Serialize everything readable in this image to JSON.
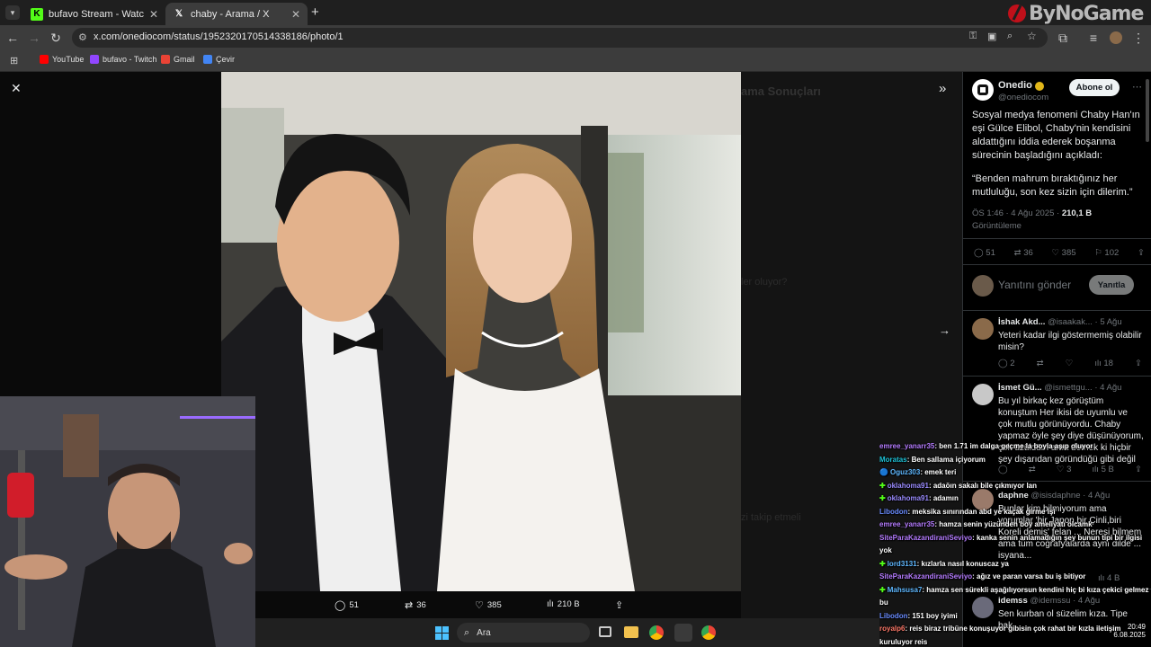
{
  "browser": {
    "tabs": [
      {
        "title": "bufavo Stream - Watch Live on",
        "icon_letter": "K",
        "icon_color": "#53fc18"
      },
      {
        "title": "chaby - Arama / X",
        "icon_letter": "𝕏",
        "icon_color": "#ffffff"
      }
    ],
    "url": "x.com/onediocom/status/1952320170514338186/photo/1",
    "bookmarks": [
      "YouTube",
      "bufavo - Twitch",
      "Gmail",
      "Çevir"
    ],
    "watermark": "ByNoGame"
  },
  "post": {
    "author_name": "Onedio",
    "author_handle": "@onediocom",
    "follow_label": "Abone ol",
    "text": "Sosyal medya fenomeni Chaby Han'ın eşi Gülce Elibol, Chaby'nin kendisini aldattığını iddia ederek boşanma sürecinin başladığını açıkladı:",
    "quote": "“Benden mahrum bıraktığınız her mutluluğu, son kez sizin için dilerim.”",
    "time": "ÖS 1:46 · 4 Ağu 2025 ·",
    "views_count": "210,1 B",
    "views_label": "Görüntüleme",
    "stats": {
      "replies": "51",
      "reposts": "36",
      "likes": "385",
      "bookmarks": "102"
    },
    "reply_placeholder": "Yanıtını gönder",
    "reply_button": "Yanıtla"
  },
  "photo_actions": {
    "replies": "51",
    "reposts": "36",
    "likes": "385",
    "views": "210 B"
  },
  "replies": [
    {
      "name": "İshak Akd...",
      "handle": "@isaakak...",
      "date": "· 5 Ağu",
      "text": "Yeteri kadar ilgi göstermemiş olabilir misin?",
      "replies": "2",
      "reposts": "",
      "likes": "",
      "views": "18",
      "avatar": "#8a6a4a"
    },
    {
      "name": "İsmet Gü...",
      "handle": "@ismettgu...",
      "date": "· 4 Ağu",
      "text": "Bu yıl birkaç kez görüştüm konuştum Her ikisi de uyumlu ve çok mutlu görünüyordu. Chaby yapmaz öyle şey diye düşünüyorum, çok üzüldüm ama demek ki hiçbir şey dışarıdan göründüğü gibi değil",
      "replies": "",
      "reposts": "",
      "likes": "3",
      "views": "5 B",
      "avatar": "#c8c8c8"
    },
    {
      "name": "daphne",
      "handle": "@isisdaphne",
      "date": "· 4 Ağu",
      "text": "Bunlar kim bilmiyorum ama yorumlar 'bir Japon,bir Çinli,biri Koreli demiş' felan ... Neresi bilmem ama tüm coğrafyalarda aynı dilde ... isyana...",
      "replies": "",
      "reposts": "",
      "likes": "",
      "views": "4 B",
      "avatar": "#9a7a6a"
    },
    {
      "name": "idemss",
      "handle": "@idemssu",
      "date": "· 4 Ağu",
      "text": "Sen kurban ol süzelim kıza. Tipe bak",
      "replies": "",
      "reposts": "",
      "likes": "",
      "views": "",
      "avatar": "#6a6a7a"
    }
  ],
  "chat": [
    {
      "user": "emree_yanarr35",
      "color": "#b57cff",
      "msg": ": ben 1.71 im dalga geçme la boyla aşıp oluyor",
      "badge": ""
    },
    {
      "user": "Moratas",
      "color": "#1fc3d8",
      "msg": ": Ben sallama içiyorum",
      "badge": ""
    },
    {
      "user": "Oguz303",
      "color": "#5fb8ff",
      "msg": ": emek teri",
      "badge": "🔵"
    },
    {
      "user": "oklahoma91",
      "color": "#9b8cff",
      "msg": ": adaöın sakalı bile çıkmıyor lan",
      "badge": "✚"
    },
    {
      "user": "oklahoma91",
      "color": "#9b8cff",
      "msg": ": adamın",
      "badge": "✚"
    },
    {
      "user": "Libodon",
      "color": "#6a8cff",
      "msg": ": meksika sınırından abd ye kaçak girme işi",
      "badge": ""
    },
    {
      "user": "emree_yanarr35",
      "color": "#b57cff",
      "msg": ": hamza senin yüzünden boy ameliyatı olcamk",
      "badge": ""
    },
    {
      "user": "SiteParaKazandiraniSeviyo",
      "color": "#b57cff",
      "msg": ": kanka senin anlamadığın şey bunun tipi bir ilgisi",
      "badge": ""
    },
    {
      "user": "",
      "color": "#ffffff",
      "msg": "yok",
      "badge": ""
    },
    {
      "user": "lord3131",
      "color": "#5fb8ff",
      "msg": ": kızlarla nasıl konuscaz ya",
      "badge": "✚"
    },
    {
      "user": "SiteParaKazandiraniSeviyo",
      "color": "#b57cff",
      "msg": ": ağız ve paran varsa bu iş bitiyor",
      "badge": ""
    },
    {
      "user": "Mahsusa7",
      "color": "#5fb8ff",
      "msg": ": hamza sen sürekli aşağılıyorsun kendini hiç bi kıza çekici gelmez",
      "badge": "✚"
    },
    {
      "user": "",
      "color": "#ffffff",
      "msg": "bu",
      "badge": ""
    },
    {
      "user": "Libodon",
      "color": "#6a8cff",
      "msg": ": 151 boy iyimi",
      "badge": ""
    },
    {
      "user": "royalp6",
      "color": "#ff7a6a",
      "msg": ": reis biraz tribüne konuşuyor gibisin çok rahat bir kızla iletişim",
      "badge": ""
    },
    {
      "user": "",
      "color": "#ffffff",
      "msg": "kuruluyor reis",
      "badge": ""
    }
  ],
  "taskbar": {
    "search": "Ara",
    "time": "20:49",
    "date": "6.08.2025"
  },
  "colors": {
    "accent": "#1d9bf0",
    "verified": "#e2b719",
    "background": "#000000"
  }
}
